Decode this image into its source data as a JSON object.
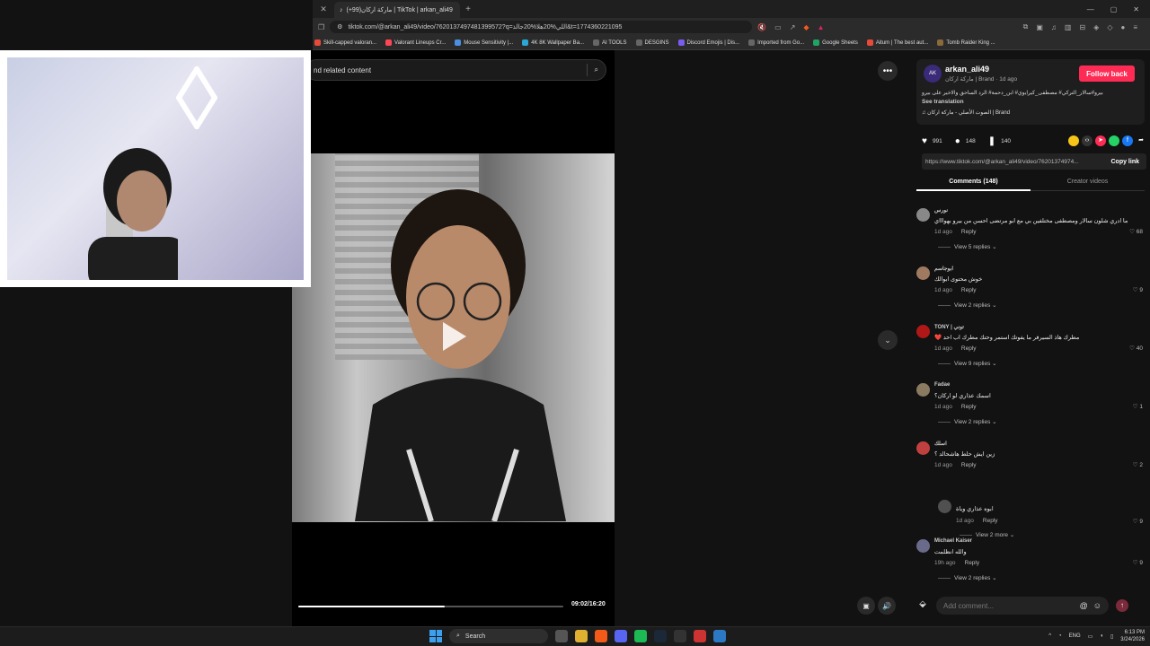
{
  "browser": {
    "tab_title": "ماركة اركان(99+) | TikTok | arkan_ali49",
    "url": "tiktok.com/@arkan_ali49/video/7620137497481399572?q=اللي%20هلا%20جالذ&t=1774360221095",
    "bookmarks": [
      {
        "label": "Skill-capped valoran...",
        "color": "#e84a3a"
      },
      {
        "label": "Valorant Lineups Cr...",
        "color": "#ff4655"
      },
      {
        "label": "Mouse Sensitivity |...",
        "color": "#4a90e2"
      },
      {
        "label": "4K 8K Wallpaper Ba...",
        "color": "#2aa8d6"
      },
      {
        "label": "AI TOOLS",
        "color": "#666666"
      },
      {
        "label": "DESGINS",
        "color": "#666666"
      },
      {
        "label": "Discord Emojis | Dis...",
        "color": "#7a5cf0"
      },
      {
        "label": "Imported from Go...",
        "color": "#666666"
      },
      {
        "label": "Google Sheets",
        "color": "#1fa463"
      },
      {
        "label": "Aitum | The best aut...",
        "color": "#e84a3a"
      },
      {
        "label": "Tomb Raider King ...",
        "color": "#8a6a3a"
      }
    ]
  },
  "player": {
    "search_placeholder": "nd related content",
    "timecode": "09:02/16:20",
    "progress": 0.553
  },
  "author": {
    "avatar_text": "AK",
    "name": "arkan_ali49",
    "sub": "ماركة اركان | Brand · 1d ago",
    "follow_label": "Follow back",
    "caption": "بيرو#سالار_التركي# مصطفى_كيرايوي# ابن_دحمة# الرد الساحق والاخير على بيرو",
    "see_translation": "See translation",
    "sound": "♫  الصوت الأصلي - ماركة اركان | Brand"
  },
  "actions": {
    "likes": "991",
    "comments": "148",
    "saves": "140"
  },
  "link": {
    "url": "https://www.tiktok.com/@arkan_ali49/video/76201374974...",
    "copy_label": "Copy link"
  },
  "tabs": {
    "comments": "Comments (148)",
    "creator": "Creator videos"
  },
  "comments": [
    {
      "user": "نورس",
      "text": "ما ادري شلون سالار ومصطفى مختلفين بي مع ابو مرتضى احسن من بيرو بهواااي",
      "time": "1d ago",
      "reply": "Reply",
      "likes": "68",
      "view": "View 5 replies",
      "avatar": "#888888"
    },
    {
      "user": "ابوجاسم",
      "text": "خوش محتوى ابوالك",
      "time": "1d ago",
      "reply": "Reply",
      "likes": "9",
      "view": "View 2 replies",
      "avatar": "#a07a60"
    },
    {
      "user": "TONY | توني",
      "text": "مطرك هاذ السيرفر ما يفوتك استمر وحتك مطرك اب احد ❤️",
      "time": "1d ago",
      "reply": "Reply",
      "likes": "40",
      "view": "View 9 replies",
      "avatar": "#b01818"
    },
    {
      "user": "Fadae",
      "text": "اسمك عذاري لو اركان؟",
      "time": "1d ago",
      "reply": "Reply",
      "likes": "1",
      "view": "View 2 replies",
      "avatar": "#8a7a60"
    },
    {
      "user": "اسلك",
      "text": "زين ايش حلط هاشحالد ؟",
      "time": "1d ago",
      "reply": "Reply",
      "likes": "2",
      "view": "",
      "avatar": "#c04040"
    }
  ],
  "reply_item": {
    "text": "ابوه عذاري وياة",
    "time": "1d ago",
    "reply": "Reply",
    "likes": "9",
    "view": "View 2 more",
    "avatar": "#505050"
  },
  "comment_last": {
    "user": "Michael Kaiser",
    "text": "والله انظلمت",
    "time": "19h ago",
    "reply": "Reply",
    "likes": "9",
    "view": "View 2 replies",
    "avatar": "#6a6a8a"
  },
  "add_comment": {
    "placeholder": "Add comment..."
  },
  "taskbar": {
    "search_label": "Search",
    "lang": "ENG",
    "time": "6:13 PM",
    "date": "3/24/2026"
  }
}
